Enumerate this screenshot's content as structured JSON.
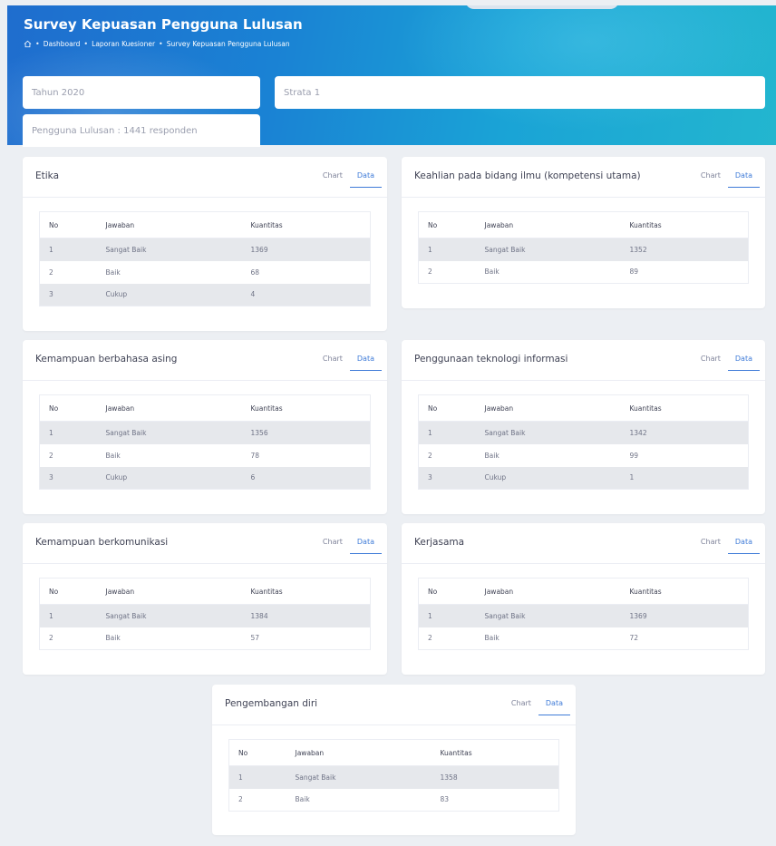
{
  "page": {
    "title": "Survey Kepuasan Pengguna Lulusan",
    "breadcrumb": [
      "Dashboard",
      "Laporan Kuesioner",
      "Survey Kepuasan Pengguna Lulusan"
    ]
  },
  "filters": {
    "year": "Tahun 2020",
    "strata": "Strata 1",
    "respondents": "Pengguna Lulusan : 1441 responden"
  },
  "table_headers": {
    "no": "No",
    "jawaban": "Jawaban",
    "kuantitas": "Kuantitas"
  },
  "tabs": {
    "chart": "Chart",
    "data": "Data"
  },
  "cards": [
    {
      "title": "Etika",
      "rows": [
        {
          "no": "1",
          "jawaban": "Sangat Baik",
          "kuantitas": "1369"
        },
        {
          "no": "2",
          "jawaban": "Baik",
          "kuantitas": "68"
        },
        {
          "no": "3",
          "jawaban": "Cukup",
          "kuantitas": "4"
        }
      ]
    },
    {
      "title": "Keahlian pada bidang ilmu (kompetensi utama)",
      "rows": [
        {
          "no": "1",
          "jawaban": "Sangat Baik",
          "kuantitas": "1352"
        },
        {
          "no": "2",
          "jawaban": "Baik",
          "kuantitas": "89"
        }
      ]
    },
    {
      "title": "Kemampuan berbahasa asing",
      "rows": [
        {
          "no": "1",
          "jawaban": "Sangat Baik",
          "kuantitas": "1356"
        },
        {
          "no": "2",
          "jawaban": "Baik",
          "kuantitas": "78"
        },
        {
          "no": "3",
          "jawaban": "Cukup",
          "kuantitas": "6"
        }
      ]
    },
    {
      "title": "Penggunaan teknologi informasi",
      "rows": [
        {
          "no": "1",
          "jawaban": "Sangat Baik",
          "kuantitas": "1342"
        },
        {
          "no": "2",
          "jawaban": "Baik",
          "kuantitas": "99"
        },
        {
          "no": "3",
          "jawaban": "Cukup",
          "kuantitas": "1"
        }
      ]
    },
    {
      "title": "Kemampuan berkomunikasi",
      "rows": [
        {
          "no": "1",
          "jawaban": "Sangat Baik",
          "kuantitas": "1384"
        },
        {
          "no": "2",
          "jawaban": "Baik",
          "kuantitas": "57"
        }
      ]
    },
    {
      "title": "Kerjasama",
      "rows": [
        {
          "no": "1",
          "jawaban": "Sangat Baik",
          "kuantitas": "1369"
        },
        {
          "no": "2",
          "jawaban": "Baik",
          "kuantitas": "72"
        }
      ]
    },
    {
      "title": "Pengembangan diri",
      "rows": [
        {
          "no": "1",
          "jawaban": "Sangat Baik",
          "kuantitas": "1358"
        },
        {
          "no": "2",
          "jawaban": "Baik",
          "kuantitas": "83"
        }
      ]
    }
  ],
  "colors": {
    "accent": "#3f7bd8",
    "hero_start": "#1f6dce",
    "hero_end": "#23b6cf",
    "row_stripe": "#e6e8ec"
  }
}
